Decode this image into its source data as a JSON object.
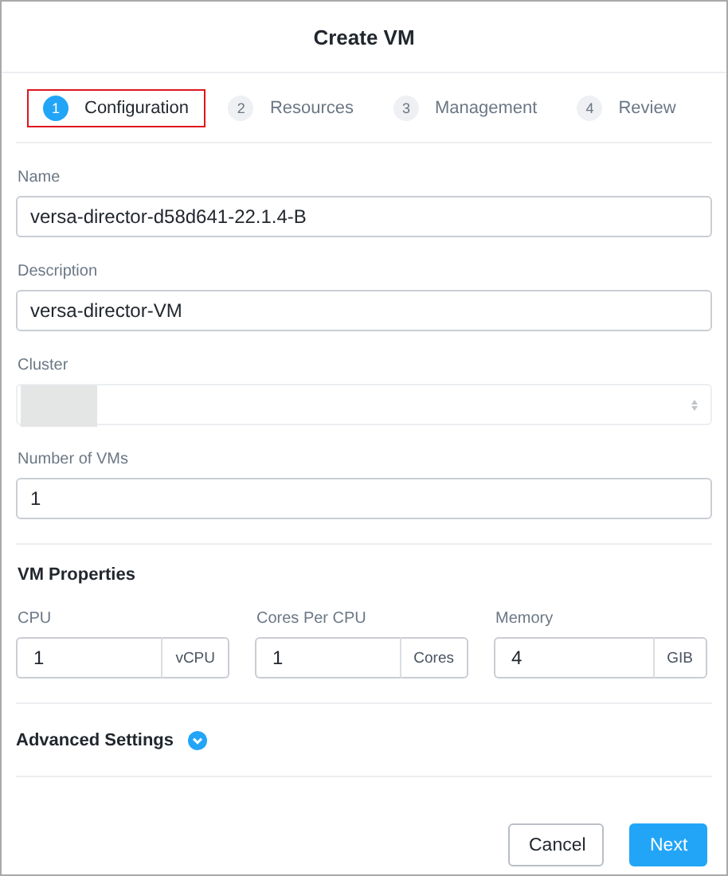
{
  "window": {
    "title": "Create VM"
  },
  "steps": [
    {
      "number": "1",
      "label": "Configuration",
      "selected": true,
      "highlighted": true
    },
    {
      "number": "2",
      "label": "Resources",
      "selected": false,
      "highlighted": false
    },
    {
      "number": "3",
      "label": "Management",
      "selected": false,
      "highlighted": false
    },
    {
      "number": "4",
      "label": "Review",
      "selected": false,
      "highlighted": false
    }
  ],
  "fields": [
    {
      "kind": "text",
      "label": "Name",
      "value": "versa-director-d58d641-22.1.4-B"
    },
    {
      "kind": "text",
      "label": "Description",
      "value": "versa-director-VM"
    },
    {
      "kind": "select",
      "label": "Cluster",
      "disabled": true,
      "redacted": true
    },
    {
      "kind": "text",
      "label": "Number of VMs",
      "value": "1"
    }
  ],
  "vm_properties": {
    "title": "VM Properties",
    "fields": [
      {
        "label": "CPU",
        "value": "1",
        "unit": "vCPU"
      },
      {
        "label": "Cores Per CPU",
        "value": "1",
        "unit": "Cores"
      },
      {
        "label": "Memory",
        "value": "4",
        "unit": "GIB"
      }
    ]
  },
  "advanced_settings": {
    "label": "Advanced Settings",
    "expanded": false
  },
  "buttons": [
    {
      "label": "Cancel",
      "kind": "secondary"
    },
    {
      "label": "Next",
      "kind": "primary"
    }
  ]
}
